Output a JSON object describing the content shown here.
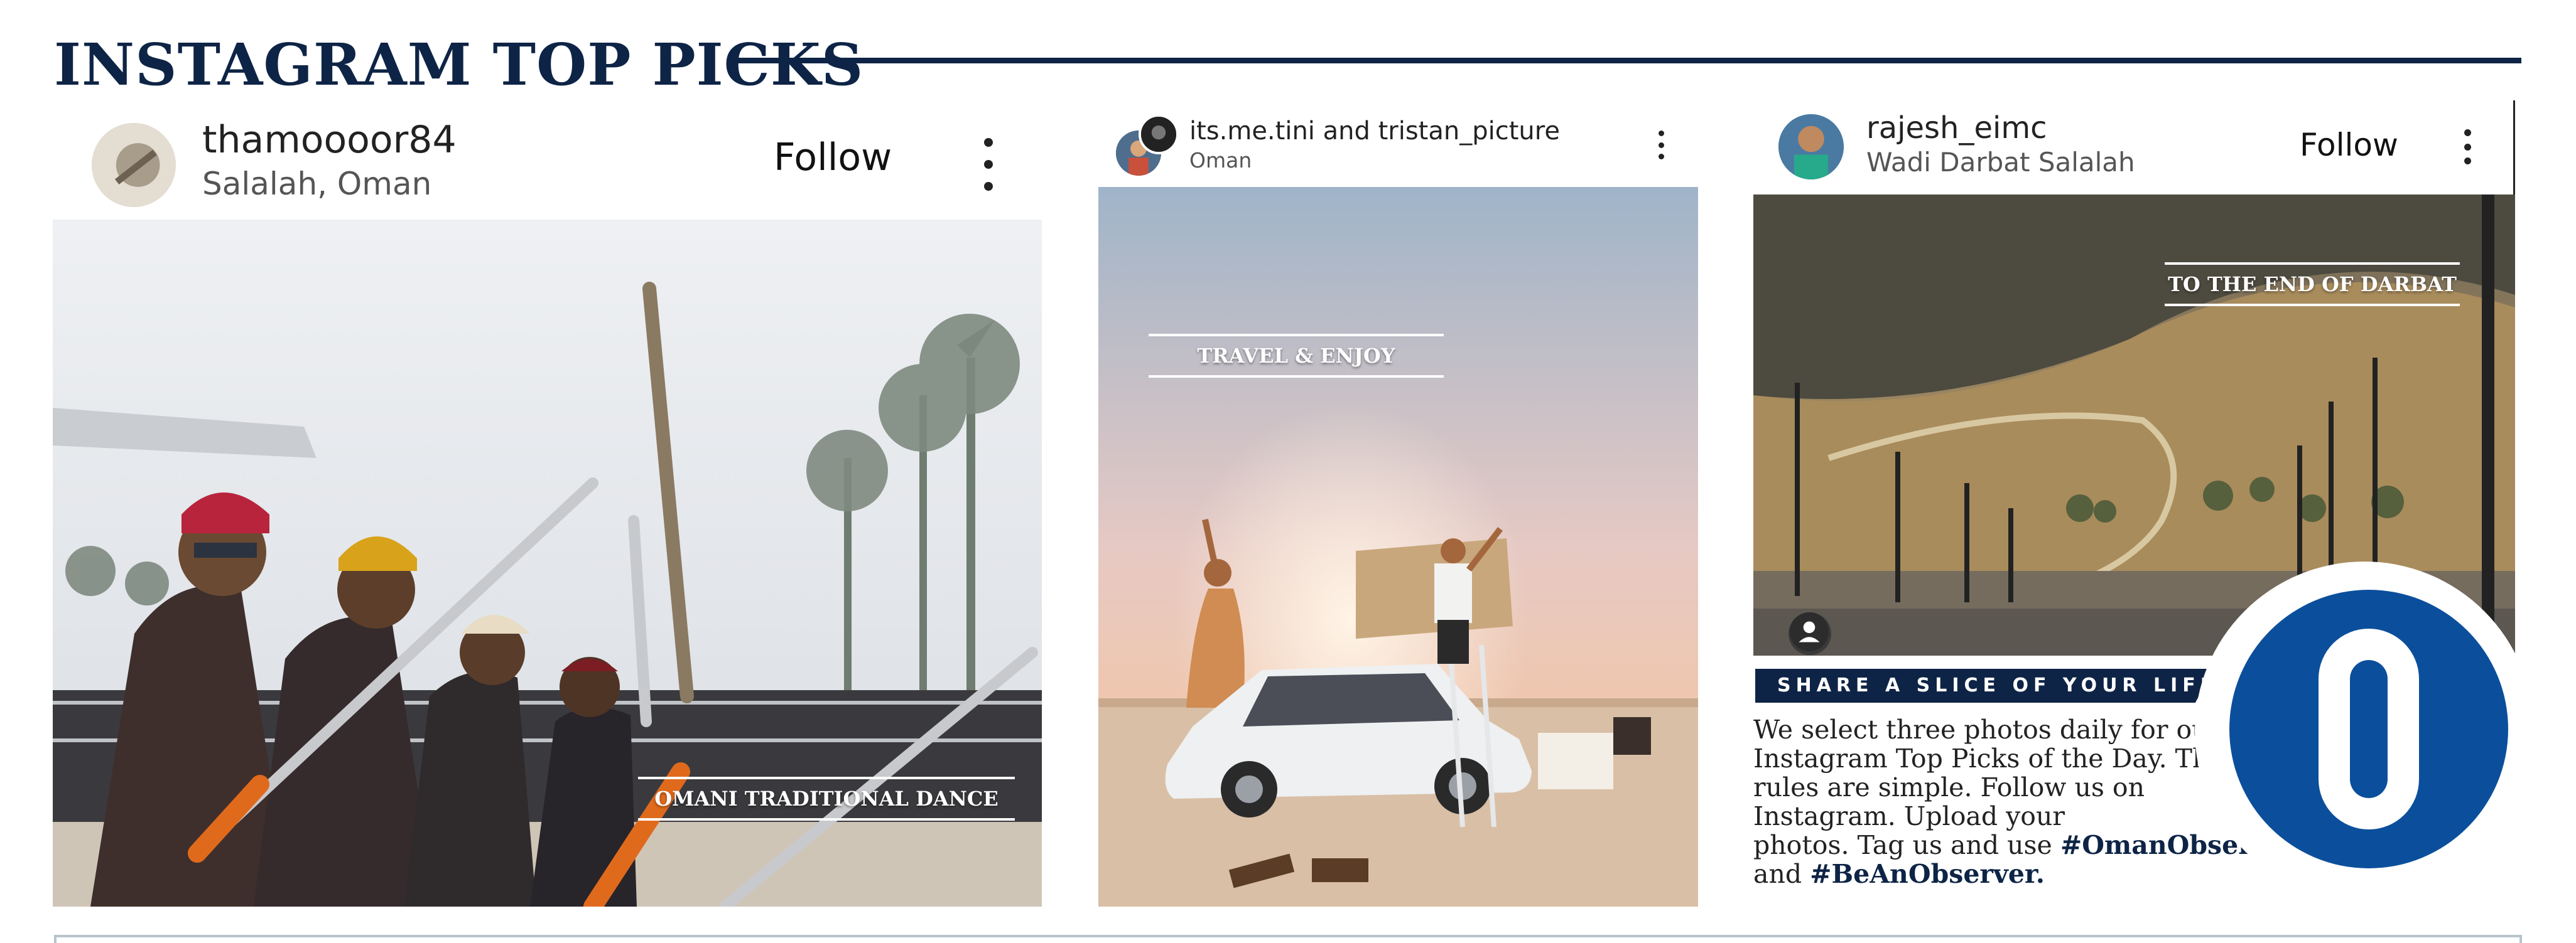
{
  "section": {
    "title": "INSTAGRAM TOP PICKS"
  },
  "posts": [
    {
      "username": "thamoooor84",
      "location": "Salalah, Oman",
      "follow_label": "Follow",
      "photo_caption": "OMANI TRADITIONAL DANCE"
    },
    {
      "username": "its.me.tini and tristan_picture",
      "location": "Oman",
      "photo_caption": "TRAVEL & ENJOY"
    },
    {
      "username": "rajesh_eimc",
      "location": "Wadi Darbat Salalah",
      "follow_label": "Follow",
      "photo_caption": "TO THE END OF DARBAT"
    }
  ],
  "share": {
    "banner": "SHARE A SLICE OF YOUR LIFE",
    "line1": "We select three photos daily for our",
    "line2": "Instagram Top Picks of the Day. The",
    "line3": "rules are simple. Follow us on",
    "line4": "Instagram. Upload your",
    "line5_pre": "photos. Tag us and use ",
    "hashtag1": "#OmanObserver",
    "line6_pre": "and ",
    "hashtag2": "#BeAnObserver."
  },
  "logo": {
    "letter": "O"
  },
  "colors": {
    "brand_navy": "#0e2446",
    "logo_blue": "#0b4f9c"
  },
  "icons": [
    "kebab-menu-icon",
    "user-tag-icon",
    "avatar"
  ]
}
